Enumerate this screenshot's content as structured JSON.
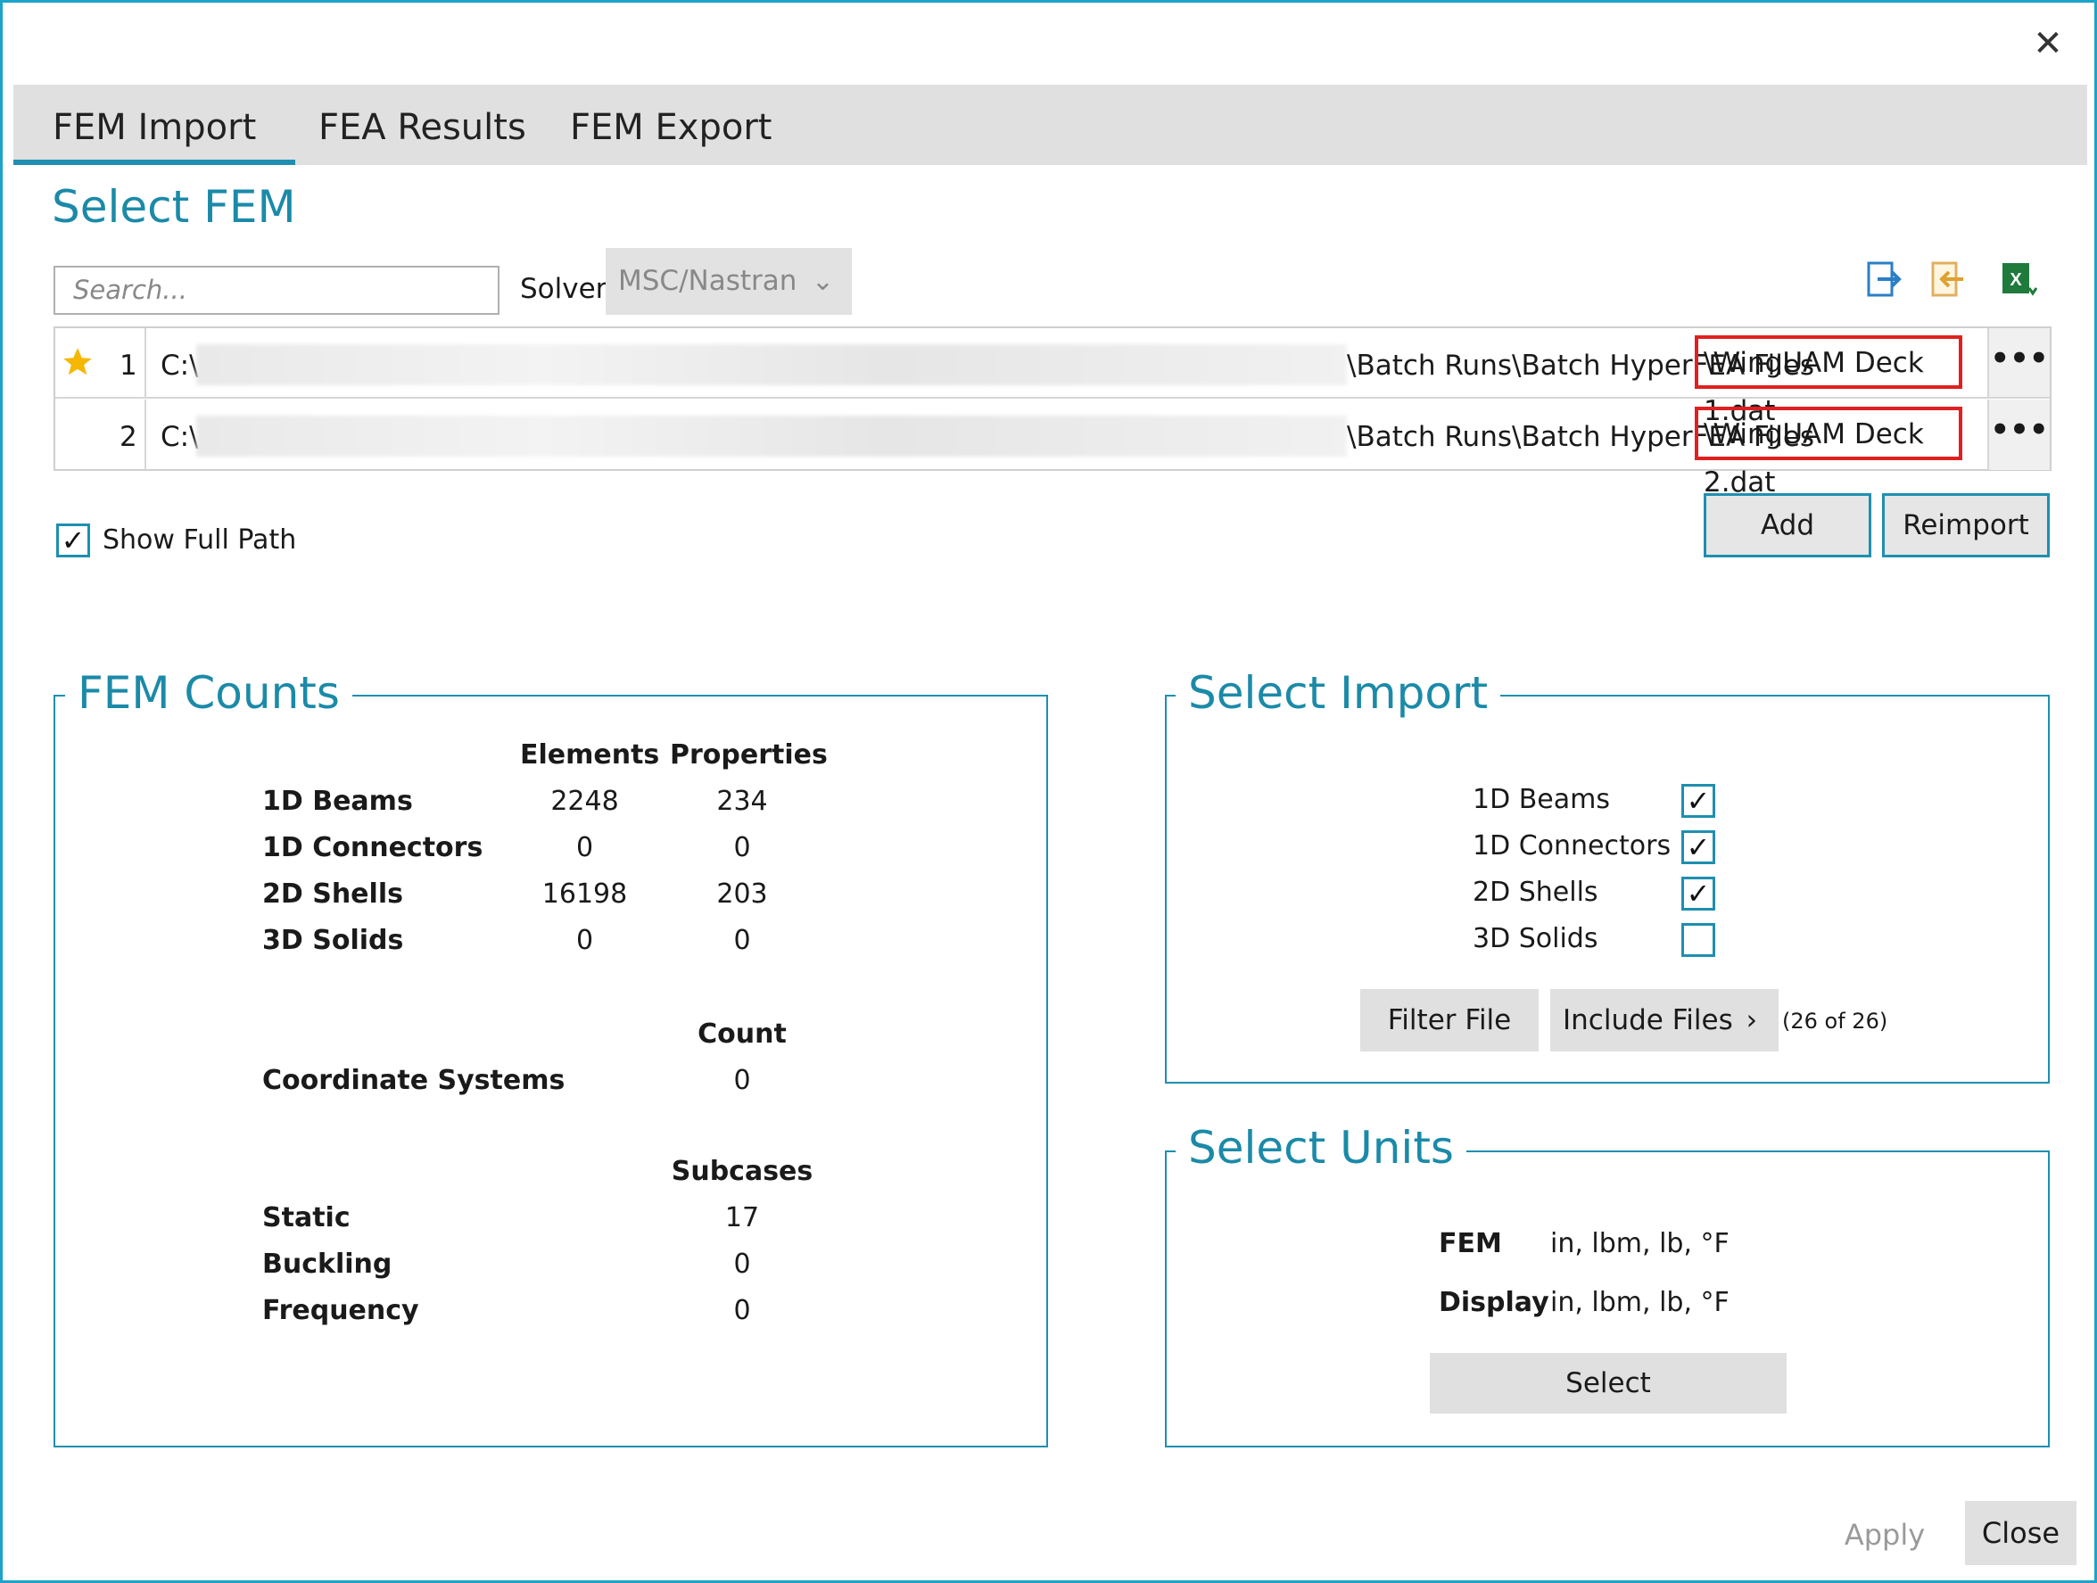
{
  "window": {
    "close_icon": "close-icon"
  },
  "tabs": [
    {
      "label": "FEM Import",
      "active": true
    },
    {
      "label": "FEA Results",
      "active": false
    },
    {
      "label": "FEM Export",
      "active": false
    }
  ],
  "select_fem": {
    "title": "Select FEM",
    "search_placeholder": "Search...",
    "solver_label": "Solver",
    "solver_value": "MSC/Nastran",
    "toolbar_icons": [
      "export-icon",
      "import-icon",
      "excel-icon"
    ]
  },
  "files": [
    {
      "index": "1",
      "starred": true,
      "drive": "C:\\",
      "path_tail": "\\Batch Runs\\Batch HyperFEA Files",
      "filename": "\\WingUAM Deck 1.dat"
    },
    {
      "index": "2",
      "starred": false,
      "drive": "C:\\",
      "path_tail": "\\Batch Runs\\Batch HyperFEA Files",
      "filename": "\\WingUAM Deck 2.dat"
    }
  ],
  "show_full_path": {
    "label": "Show Full Path",
    "checked": true
  },
  "buttons": {
    "add": "Add",
    "reimport": "Reimport",
    "apply": "Apply",
    "close": "Close"
  },
  "fem_counts": {
    "title": "FEM Counts",
    "headers": {
      "elements": "Elements",
      "properties": "Properties",
      "count": "Count",
      "subcases": "Subcases"
    },
    "rows": [
      {
        "label": "1D Beams",
        "elements": "2248",
        "properties": "234"
      },
      {
        "label": "1D Connectors",
        "elements": "0",
        "properties": "0"
      },
      {
        "label": "2D Shells",
        "elements": "16198",
        "properties": "203"
      },
      {
        "label": "3D Solids",
        "elements": "0",
        "properties": "0"
      }
    ],
    "coordinate_systems": {
      "label": "Coordinate Systems",
      "count": "0"
    },
    "subcases": [
      {
        "label": "Static",
        "value": "17"
      },
      {
        "label": "Buckling",
        "value": "0"
      },
      {
        "label": "Frequency",
        "value": "0"
      }
    ]
  },
  "select_import": {
    "title": "Select Import",
    "items": [
      {
        "label": "1D Beams",
        "checked": true
      },
      {
        "label": "1D Connectors",
        "checked": true
      },
      {
        "label": "2D Shells",
        "checked": true
      },
      {
        "label": "3D Solids",
        "checked": false
      }
    ],
    "filter_file": "Filter File",
    "include_files": "Include Files",
    "include_count": "(26 of 26)"
  },
  "select_units": {
    "title": "Select Units",
    "fem_label": "FEM",
    "fem_value": "in, lbm, lb, °F",
    "display_label": "Display",
    "display_value": "in, lbm, lb, °F",
    "select_button": "Select"
  },
  "colors": {
    "accent": "#1e8fb0",
    "title": "#1b8aa8",
    "highlight": "#e02020",
    "star": "#f5b700"
  }
}
